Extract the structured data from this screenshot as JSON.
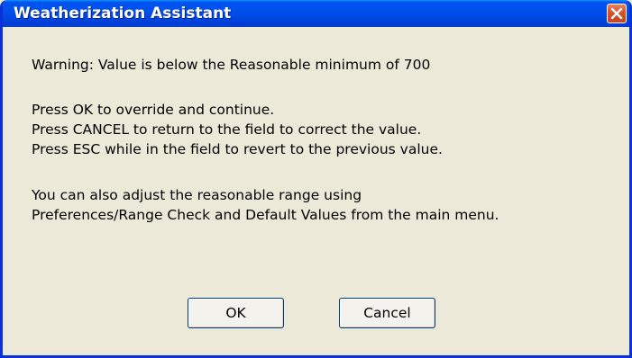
{
  "window": {
    "title": "Weatherization Assistant",
    "close_icon": "close-icon"
  },
  "message": {
    "warning": "Warning: Value is below the Reasonable minimum of 700",
    "line_ok": "Press OK to override and continue.",
    "line_cancel": "Press CANCEL to return to the field to correct the value.",
    "line_esc": "Press ESC while in the field to revert to the previous value.",
    "line_range1": "You can also adjust the reasonable range using",
    "line_range2": "Preferences/Range Check and Default Values from the main menu."
  },
  "buttons": {
    "ok_label": "OK",
    "cancel_label": "Cancel"
  },
  "colors": {
    "titlebar": "#0053ee",
    "dialog_bg": "#ece9d8",
    "close_button": "#d9512a"
  }
}
